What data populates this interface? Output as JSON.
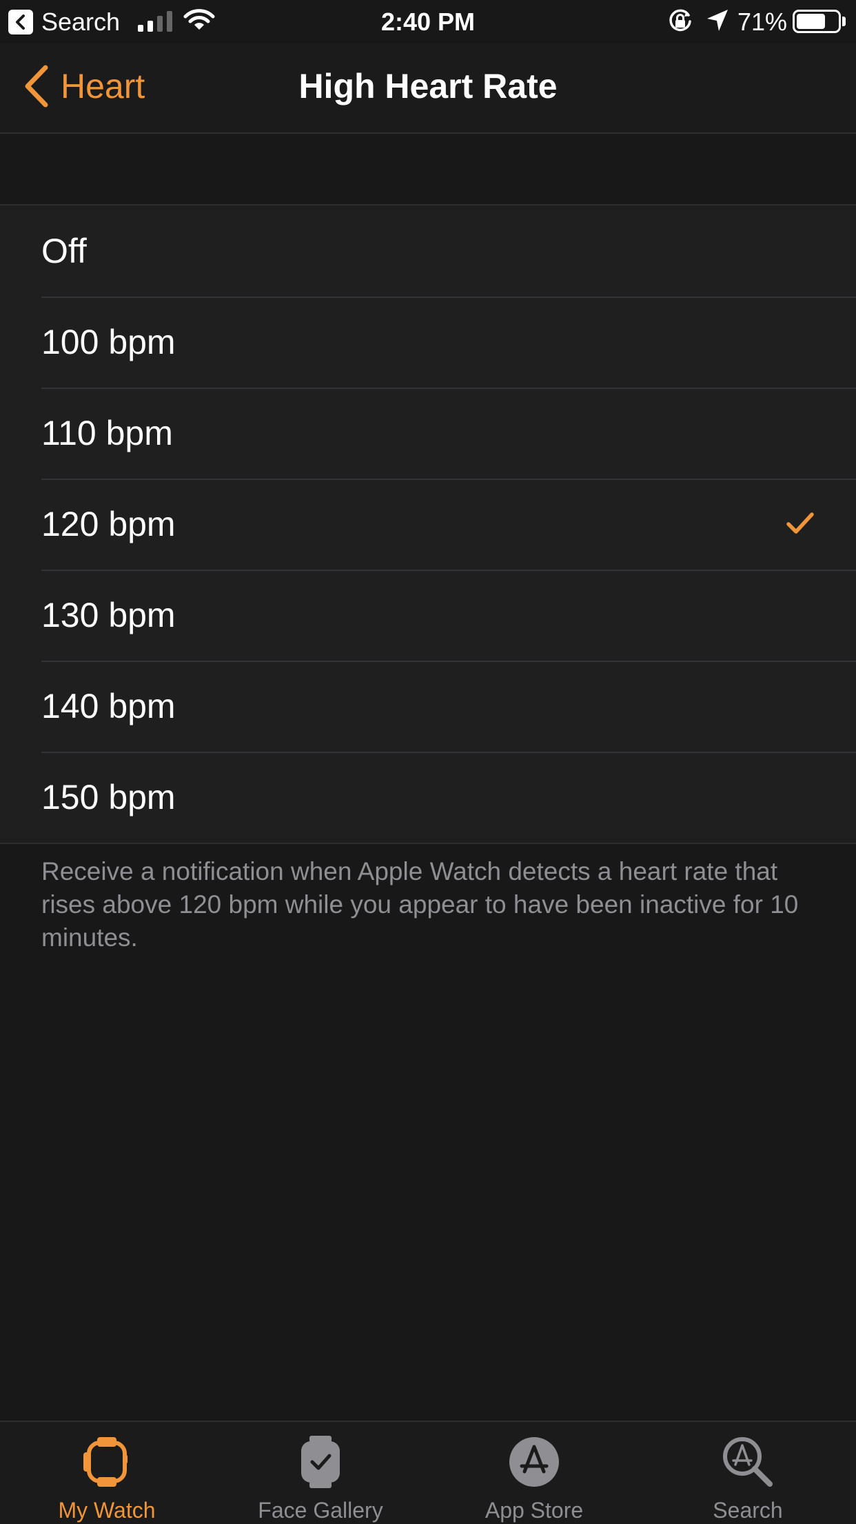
{
  "status_bar": {
    "back_app": "Search",
    "time": "2:40 PM",
    "battery_percent": "71%",
    "battery_level": 0.71
  },
  "nav": {
    "back_label": "Heart",
    "title": "High Heart Rate"
  },
  "options": [
    {
      "label": "Off",
      "selected": false
    },
    {
      "label": "100 bpm",
      "selected": false
    },
    {
      "label": "110 bpm",
      "selected": false
    },
    {
      "label": "120 bpm",
      "selected": true
    },
    {
      "label": "130 bpm",
      "selected": false
    },
    {
      "label": "140 bpm",
      "selected": false
    },
    {
      "label": "150 bpm",
      "selected": false
    }
  ],
  "footer_note": "Receive a notification when Apple Watch detects a heart rate that rises above 120 bpm while you appear to have been inactive for 10 minutes.",
  "tab_bar": {
    "tabs": [
      {
        "label": "My Watch",
        "icon": "watch-icon",
        "active": true
      },
      {
        "label": "Face Gallery",
        "icon": "face-gallery-icon",
        "active": false
      },
      {
        "label": "App Store",
        "icon": "app-store-icon",
        "active": false
      },
      {
        "label": "Search",
        "icon": "search-icon",
        "active": false
      }
    ]
  },
  "colors": {
    "accent": "#f0953a",
    "background": "#181818",
    "cell": "#1f1f20",
    "secondary_text": "#8e8e93"
  }
}
